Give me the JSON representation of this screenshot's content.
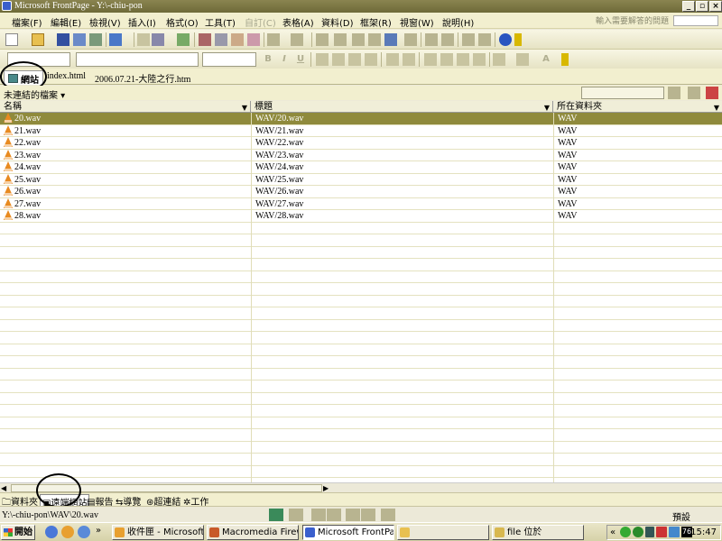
{
  "window": {
    "title": "Microsoft FrontPage - Y:\\-chiu-pon"
  },
  "menu": {
    "items": [
      {
        "label": "檔案(F)",
        "enabled": true
      },
      {
        "label": "編輯(E)",
        "enabled": true
      },
      {
        "label": "檢視(V)",
        "enabled": true
      },
      {
        "label": "插入(I)",
        "enabled": true
      },
      {
        "label": "格式(O)",
        "enabled": true
      },
      {
        "label": "工具(T)",
        "enabled": true
      },
      {
        "label": "自訂(C)",
        "enabled": false
      },
      {
        "label": "表格(A)",
        "enabled": true
      },
      {
        "label": "資料(D)",
        "enabled": true
      },
      {
        "label": "框架(R)",
        "enabled": true
      },
      {
        "label": "視窗(W)",
        "enabled": true
      },
      {
        "label": "說明(H)",
        "enabled": true
      }
    ],
    "help_box": "輸入需要解答的問題"
  },
  "toolbar2": {
    "bold": "B",
    "italic": "I",
    "underline": "U",
    "font_color": "A"
  },
  "tabs": [
    {
      "label": "網站"
    },
    {
      "label": "index.html"
    },
    {
      "label": "2006.07.21-大陸之行.htm"
    }
  ],
  "view_header": {
    "label": "未連結的檔案"
  },
  "columns": [
    {
      "label": "名稱"
    },
    {
      "label": "標題"
    },
    {
      "label": "所在資料夾"
    }
  ],
  "files": [
    {
      "name": "20.wav",
      "title": "WAV/20.wav",
      "folder": "WAV",
      "selected": true
    },
    {
      "name": "21.wav",
      "title": "WAV/21.wav",
      "folder": "WAV",
      "selected": false
    },
    {
      "name": "22.wav",
      "title": "WAV/22.wav",
      "folder": "WAV",
      "selected": false
    },
    {
      "name": "23.wav",
      "title": "WAV/23.wav",
      "folder": "WAV",
      "selected": false
    },
    {
      "name": "24.wav",
      "title": "WAV/24.wav",
      "folder": "WAV",
      "selected": false
    },
    {
      "name": "25.wav",
      "title": "WAV/25.wav",
      "folder": "WAV",
      "selected": false
    },
    {
      "name": "26.wav",
      "title": "WAV/26.wav",
      "folder": "WAV",
      "selected": false
    },
    {
      "name": "27.wav",
      "title": "WAV/27.wav",
      "folder": "WAV",
      "selected": false
    },
    {
      "name": "28.wav",
      "title": "WAV/28.wav",
      "folder": "WAV",
      "selected": false
    }
  ],
  "viewbar": {
    "folders": "資料夾",
    "remote": "遠端網站",
    "reports": "報告",
    "navigation": "導覽",
    "hyperlinks": "超連結",
    "tasks": "工作"
  },
  "status": {
    "path": "Y:\\-chiu-pon\\WAV\\20.wav",
    "mode": "預設"
  },
  "taskbar": {
    "start": "開始",
    "more": "»",
    "tasks": [
      {
        "label": "收件匣 - Microsoft ...",
        "active": false
      },
      {
        "label": "Macromedia Firewo...",
        "active": false
      },
      {
        "label": "Microsoft FrontPage...",
        "active": true
      },
      {
        "label": "",
        "active": false
      },
      {
        "label": "file 位於",
        "active": false
      }
    ],
    "tray_chevron": "«",
    "tray_badge": "76",
    "clock": "15:47"
  }
}
